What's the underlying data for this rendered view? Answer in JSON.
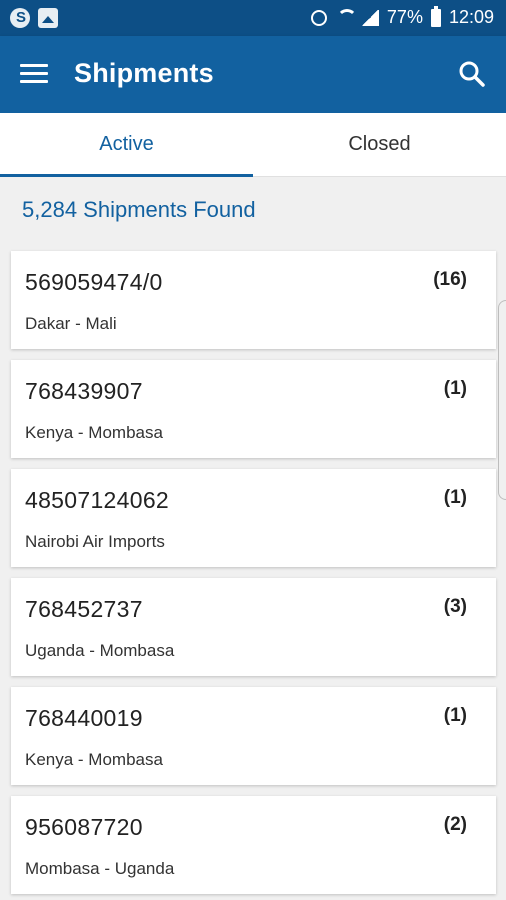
{
  "status_bar": {
    "battery": "77%",
    "time": "12:09",
    "left_icons": [
      "skype-icon",
      "gallery-icon"
    ],
    "right_icons": [
      "alarm-icon",
      "wifi-icon",
      "signal-icon",
      "battery-icon"
    ]
  },
  "app_bar": {
    "title": "Shipments",
    "menu_icon": "hamburger-menu-icon",
    "search_icon": "search-icon",
    "color": "#1261a0"
  },
  "tabs": [
    {
      "label": "Active",
      "selected": true
    },
    {
      "label": "Closed",
      "selected": false
    }
  ],
  "summary": "5,284 Shipments Found",
  "shipments": [
    {
      "id": "569059474/0",
      "route": "Dakar - Mali",
      "count": "(16)"
    },
    {
      "id": "768439907",
      "route": "Kenya - Mombasa",
      "count": "(1)"
    },
    {
      "id": "48507124062",
      "route": "Nairobi Air Imports",
      "count": "(1)"
    },
    {
      "id": "768452737",
      "route": "Uganda - Mombasa",
      "count": "(3)"
    },
    {
      "id": "768440019",
      "route": "Kenya - Mombasa",
      "count": "(1)"
    },
    {
      "id": "956087720",
      "route": "Mombasa - Uganda",
      "count": "(2)"
    }
  ]
}
